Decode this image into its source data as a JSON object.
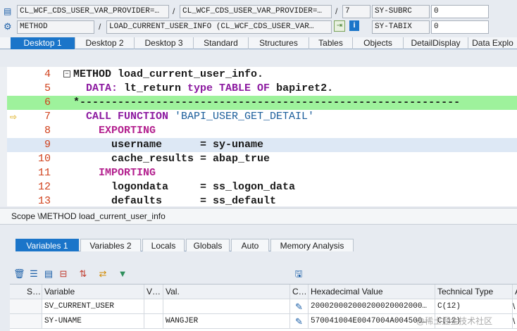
{
  "header": {
    "row1": {
      "program": "CL_WCF_CDS_USER_VAR_PROVIDER=…",
      "sep1": "/",
      "include": "CL_WCF_CDS_USER_VAR_PROVIDER=…",
      "sep2": "/",
      "line": "7",
      "sysvar": "SY-SUBRC",
      "sysval": "0"
    },
    "row2": {
      "type": "METHOD",
      "sep1": "/",
      "name": "LOAD_CURRENT_USER_INFO (CL_WCF_CDS_USER_VAR…",
      "sysvar": "SY-TABIX",
      "sysval": "0"
    }
  },
  "tabs": [
    "Desktop 1",
    "Desktop 2",
    "Desktop 3",
    "Standard",
    "Structures",
    "Tables",
    "Objects",
    "DetailDisplay",
    "Data Explo"
  ],
  "code": [
    {
      "num": "4",
      "parts": [
        {
          "cls": "plain",
          "t": "METHOD load_current_user_info."
        }
      ]
    },
    {
      "num": "5",
      "parts": [
        {
          "cls": "kw",
          "t": "  DATA: "
        },
        {
          "cls": "plain",
          "t": "lt_return "
        },
        {
          "cls": "kw",
          "t": "type TABLE OF "
        },
        {
          "cls": "plain",
          "t": "bapiret2."
        }
      ]
    },
    {
      "num": "6",
      "parts": [
        {
          "cls": "plain",
          "t": "*------------------------------------------------------------"
        }
      ]
    },
    {
      "num": "7",
      "parts": [
        {
          "cls": "kw",
          "t": "  CALL FUNCTION "
        },
        {
          "cls": "str",
          "t": "'BAPI_USER_GET_DETAIL'"
        }
      ]
    },
    {
      "num": "8",
      "parts": [
        {
          "cls": "kw2",
          "t": "    EXPORTING"
        }
      ]
    },
    {
      "num": "9",
      "parts": [
        {
          "cls": "plain",
          "t": "      username      = sy-uname"
        }
      ]
    },
    {
      "num": "10",
      "parts": [
        {
          "cls": "plain",
          "t": "      cache_results = abap_true"
        }
      ]
    },
    {
      "num": "11",
      "parts": [
        {
          "cls": "kw2",
          "t": "    IMPORTING"
        }
      ]
    },
    {
      "num": "12",
      "parts": [
        {
          "cls": "plain",
          "t": "      logondata     = ss_logon_data"
        }
      ]
    },
    {
      "num": "13",
      "parts": [
        {
          "cls": "plain",
          "t": "      defaults      = ss_default"
        }
      ]
    }
  ],
  "scope": "Scope \\METHOD load_current_user_info",
  "var_tabs": [
    "Variables 1",
    "Variables 2",
    "Locals",
    "Globals",
    "Auto",
    "Memory Analysis"
  ],
  "grid": {
    "headers": [
      "S…",
      "Variable",
      "V…",
      "Val.",
      "C…",
      "Hexadecimal Value",
      "Technical Type",
      "A"
    ],
    "rows": [
      {
        "variable": "SV_CURRENT_USER",
        "value": "",
        "hex": "200020002000200020002000…",
        "type": "C(12)",
        "extra": "\\"
      },
      {
        "variable": "SY-UNAME",
        "value": "WANGJER",
        "hex": "570041004E0047004A004500…",
        "type": "C(12)",
        "extra": "\\"
      }
    ]
  },
  "watermark": "@稀土掘金技术社区",
  "colors": {
    "accent": "#1b75c9",
    "highlight_line": "#9ef29c",
    "current_line": "#dde8f5",
    "line_number": "#d0401b"
  }
}
